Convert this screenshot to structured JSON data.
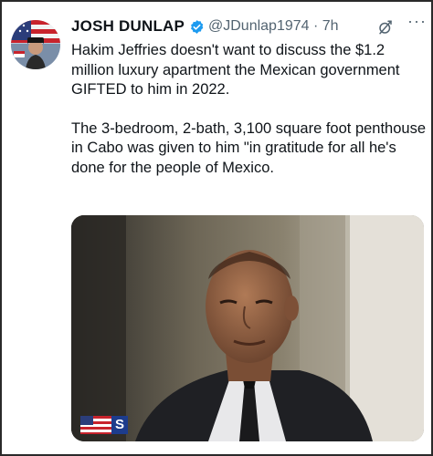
{
  "tweet": {
    "author_name": "JOSH DUNLAP",
    "handle": "@JDunlap1974",
    "separator": "·",
    "time": "7h",
    "paragraphs": [
      "Hakim Jeffries doesn't want to discuss the $1.2 million luxury apartment the Mexican government GIFTED to him in 2022.",
      "The 3-bedroom, 2-bath, 3,100 square foot penthouse in Cabo was given to him \"in gratitude for all he's done for the people of Mexico."
    ],
    "more_label": "···"
  },
  "media": {
    "logo_letter": "S"
  },
  "icons": {
    "verified": "verified-badge-icon",
    "grok": "grok-icon",
    "more": "more-options-icon"
  },
  "colors": {
    "text": "#0f1419",
    "secondary": "#536471",
    "verified": "#1d9bf0"
  }
}
